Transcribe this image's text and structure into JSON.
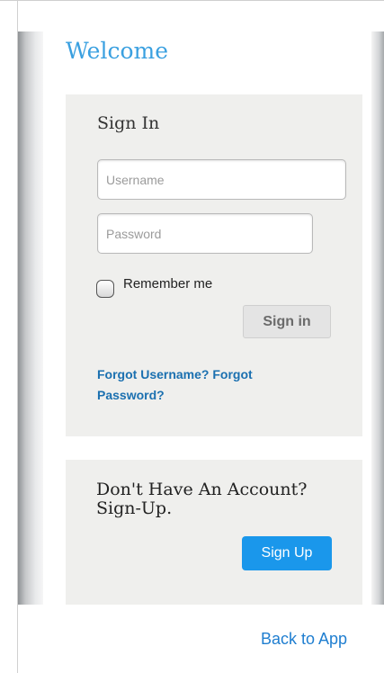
{
  "page": {
    "title": "Welcome"
  },
  "signin": {
    "title": "Sign In",
    "username_placeholder": "Username",
    "password_placeholder": "Password",
    "remember_label": "Remember me",
    "remember_checked": false,
    "button_label": "Sign in",
    "forgot_link": "Forgot Username? Forgot Password?"
  },
  "signup": {
    "title": "Don't Have An Account? Sign-Up.",
    "button_label": "Sign Up"
  },
  "footer": {
    "back_link": "Back to App"
  },
  "colors": {
    "accent": "#3aa0e0",
    "link": "#1b70b0",
    "primary_button": "#1a97eb",
    "card_background": "#efefed"
  }
}
